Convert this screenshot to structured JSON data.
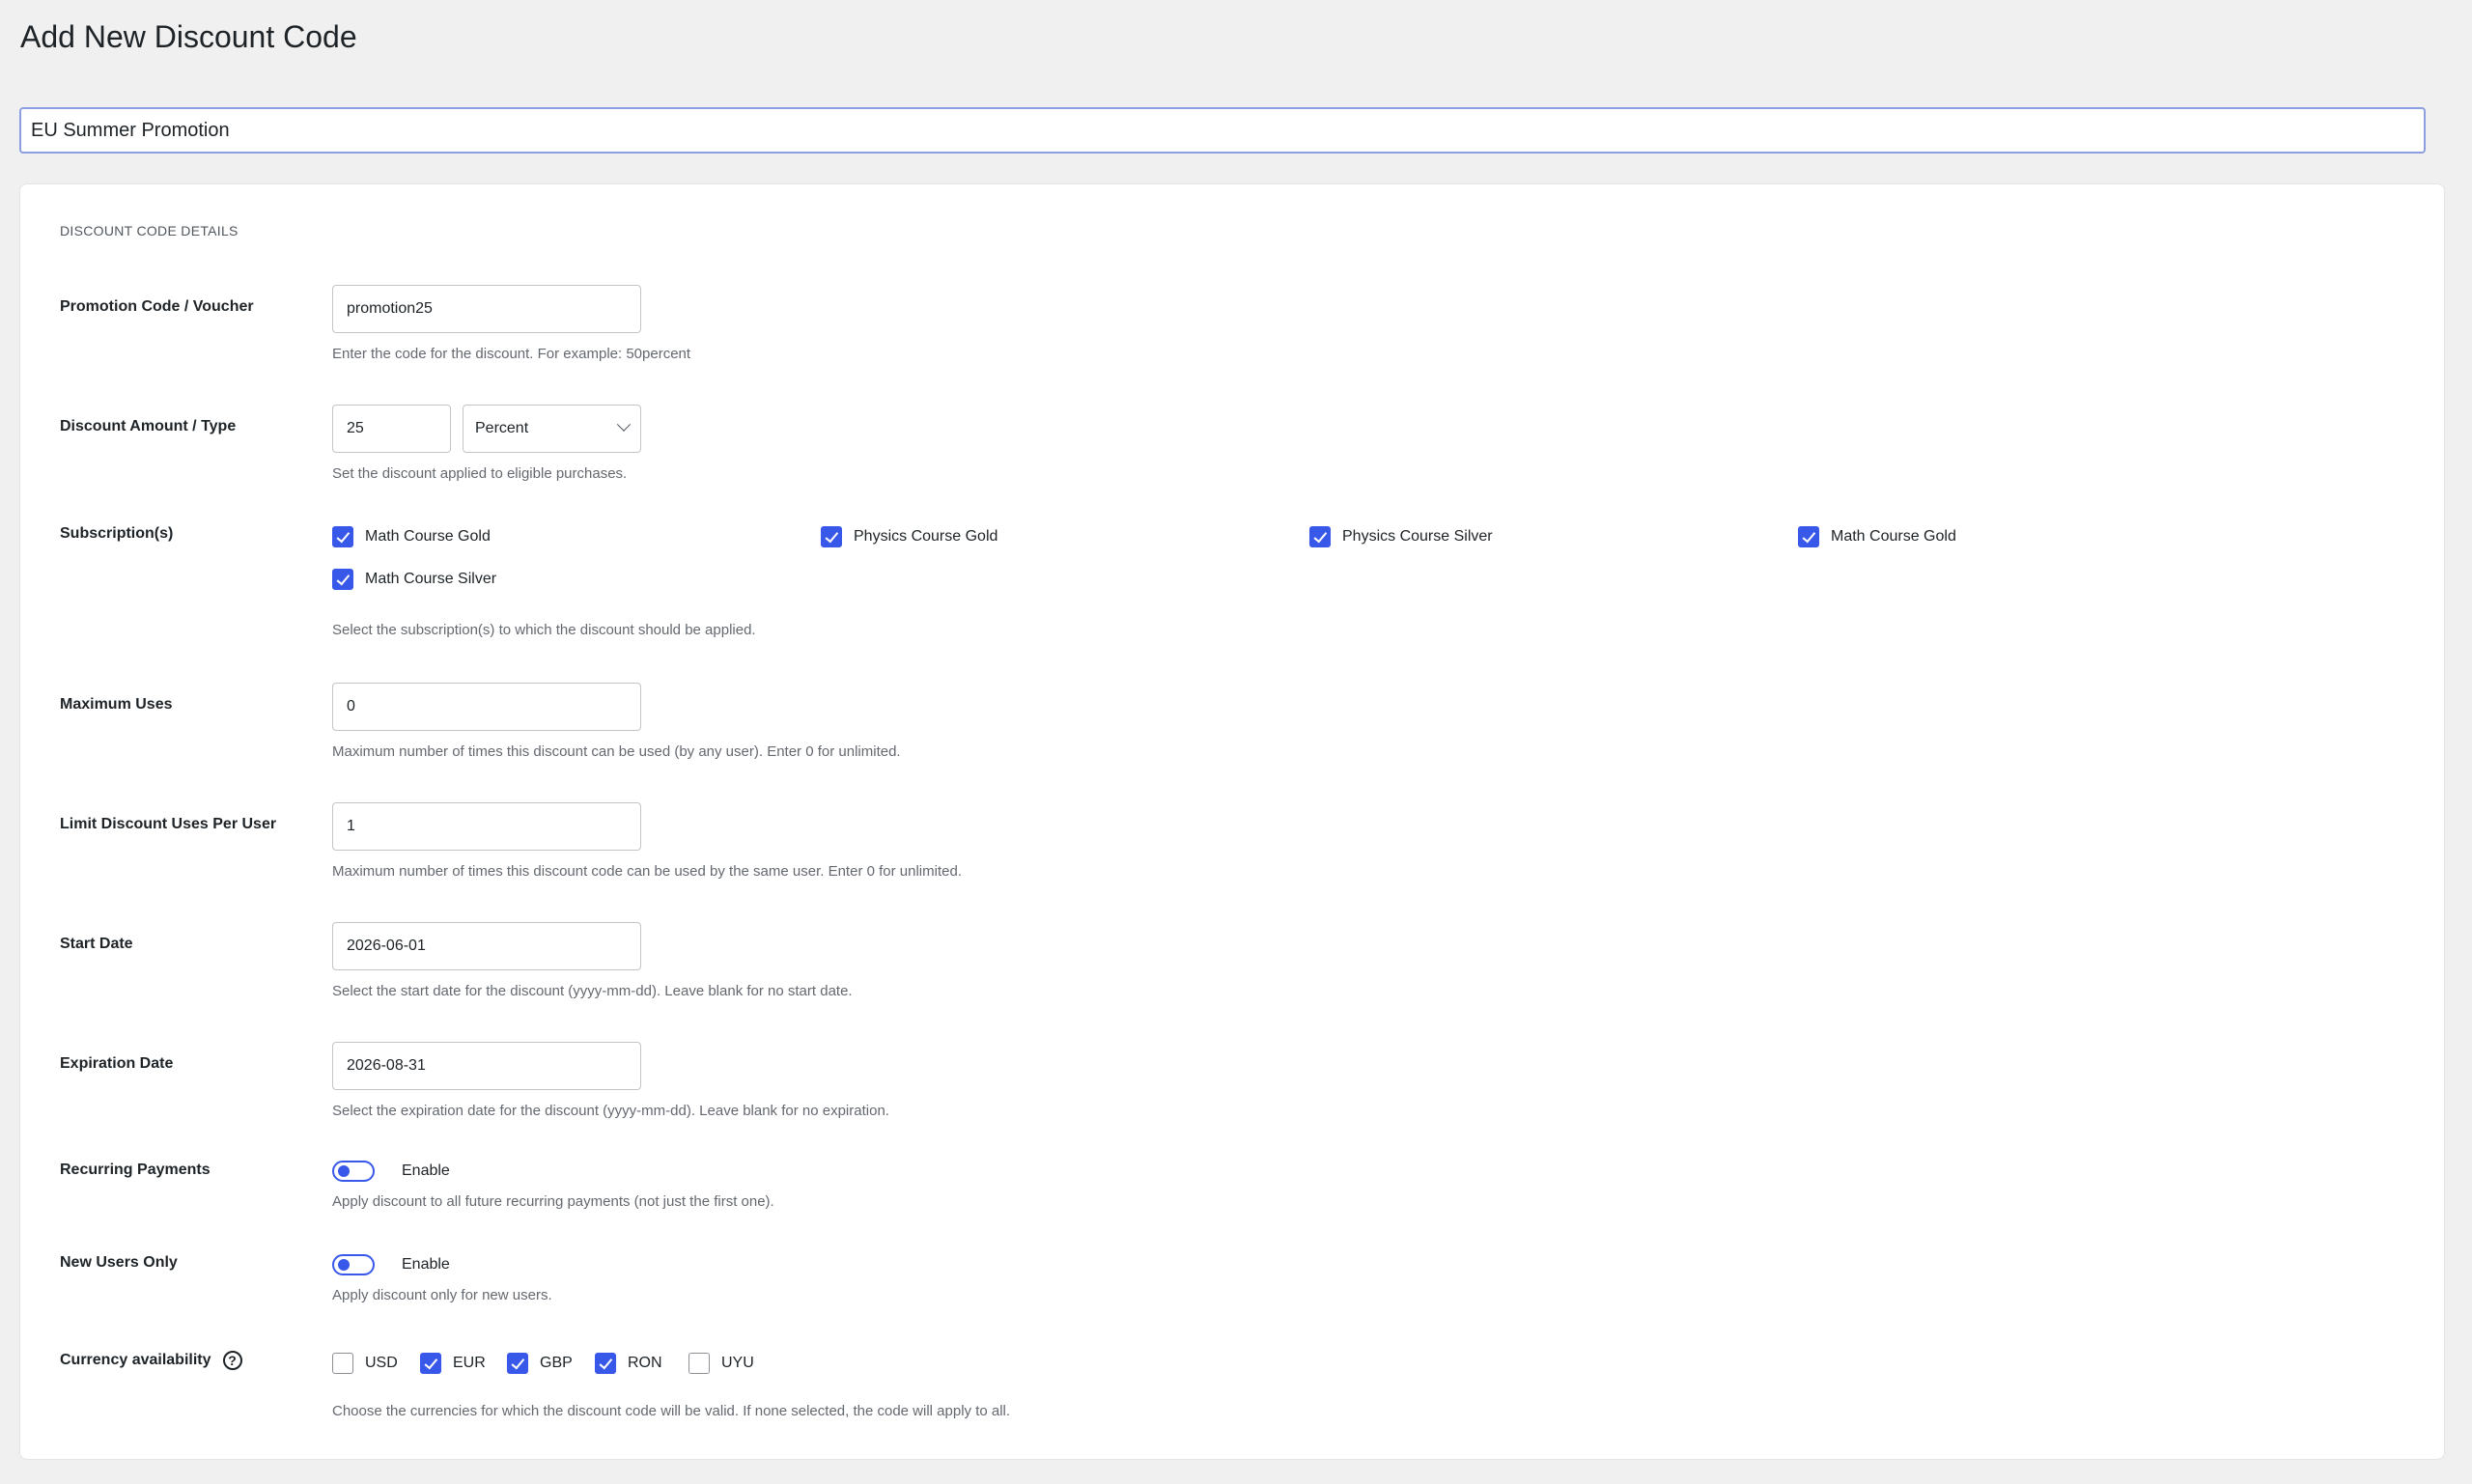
{
  "page": {
    "title": "Add New Discount Code"
  },
  "discount_name": "EU Summer Promotion",
  "section": {
    "title": "DISCOUNT CODE DETAILS"
  },
  "code": {
    "label": "Promotion Code / Voucher",
    "value": "promotion25",
    "desc": "Enter the code for the discount. For example: 50percent"
  },
  "amount": {
    "label": "Discount Amount / Type",
    "value": "25",
    "type_selected": "Percent",
    "desc": "Set the discount applied to eligible purchases."
  },
  "subscriptions": {
    "label": "Subscription(s)",
    "items": [
      {
        "label": "Math Course Gold",
        "checked": true
      },
      {
        "label": "Physics Course Gold",
        "checked": true
      },
      {
        "label": "Physics Course Silver",
        "checked": true
      },
      {
        "label": "Math Course Gold",
        "checked": true
      },
      {
        "label": "Math Course Silver",
        "checked": true
      }
    ],
    "desc": "Select the subscription(s) to which the discount should be applied."
  },
  "max_uses": {
    "label": "Maximum Uses",
    "value": "0",
    "desc": "Maximum number of times this discount can be used (by any user). Enter 0 for unlimited."
  },
  "per_user": {
    "label": "Limit Discount Uses Per User",
    "value": "1",
    "desc": "Maximum number of times this discount code can be used by the same user. Enter 0 for unlimited."
  },
  "start_date": {
    "label": "Start Date",
    "value": "2026-06-01",
    "desc": "Select the start date for the discount (yyyy-mm-dd). Leave blank for no start date."
  },
  "expiration_date": {
    "label": "Expiration Date",
    "value": "2026-08-31",
    "desc": "Select the expiration date for the discount (yyyy-mm-dd). Leave blank for no expiration."
  },
  "recurring": {
    "label": "Recurring Payments",
    "toggle_label": "Enable",
    "enabled": false,
    "desc": "Apply discount to all future recurring payments (not just the first one)."
  },
  "new_users": {
    "label": "New Users Only",
    "toggle_label": "Enable",
    "enabled": false,
    "desc": "Apply discount only for new users."
  },
  "currency": {
    "label": "Currency availability",
    "help_glyph": "?",
    "items": [
      {
        "label": "USD",
        "checked": false
      },
      {
        "label": "EUR",
        "checked": true
      },
      {
        "label": "GBP",
        "checked": true
      },
      {
        "label": "RON",
        "checked": true
      },
      {
        "label": "UYU",
        "checked": false
      }
    ],
    "desc": "Choose the currencies for which the discount code will be valid. If none selected, the code will apply to all."
  },
  "colors": {
    "accent": "#3858e9",
    "background": "#f0f0f1"
  }
}
